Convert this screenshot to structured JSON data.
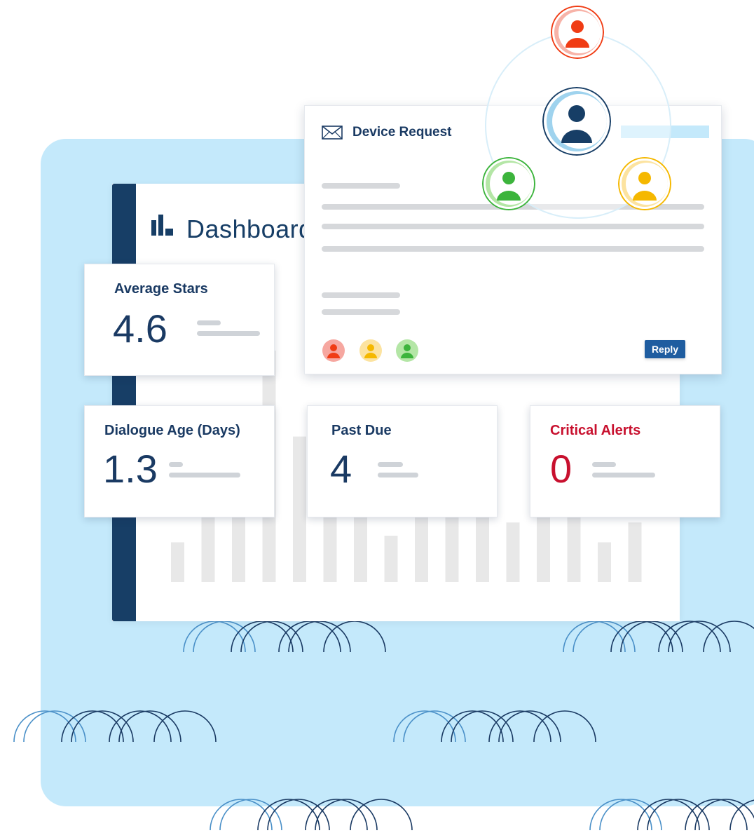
{
  "dashboard": {
    "title": "Dashboard",
    "bars": [
      6,
      11,
      16,
      35,
      22,
      26,
      18,
      7,
      12,
      19,
      17,
      9,
      17,
      14,
      6,
      9
    ],
    "bar_color": "#e8e8e8"
  },
  "metrics": {
    "average_stars": {
      "label": "Average Stars",
      "value": "4.6"
    },
    "dialogue_age": {
      "label": "Dialogue Age (Days)",
      "value": "1.3"
    },
    "past_due": {
      "label": "Past Due",
      "value": "4"
    },
    "critical_alerts": {
      "label": "Critical Alerts",
      "value": "0"
    }
  },
  "message": {
    "title": "Device Request",
    "reply_label": "Reply",
    "participants": [
      "red-user-avatar",
      "yellow-user-avatar",
      "green-user-avatar"
    ]
  },
  "colors": {
    "primary": "#1a3a63",
    "accent_blue": "#1f5da0",
    "background_panel": "#c4e9fb",
    "critical": "#c8102e",
    "user_red": "#f03c14",
    "user_green": "#3cb43c",
    "user_yellow": "#f5b800",
    "user_navy": "#173e66"
  },
  "icons": [
    "bar-chart-icon",
    "envelope-icon",
    "user-icon"
  ]
}
